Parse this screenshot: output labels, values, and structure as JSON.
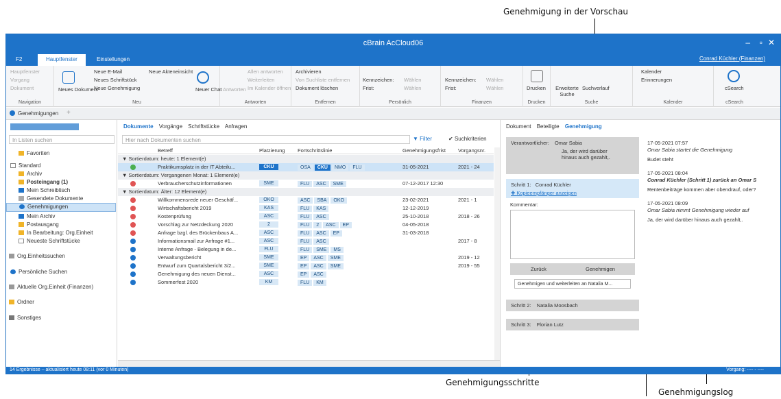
{
  "callouts": {
    "preview": "Genehmigung in der Vorschau",
    "steps": "Genehmigungsschritte",
    "log": "Genehmigungslog"
  },
  "window": {
    "title": "cBrain AcCloud06",
    "user": "Conrad Küchler (Finanzen)"
  },
  "ribbon_tabs": [
    "F2",
    "Hauptfenster",
    "Einstellungen"
  ],
  "ribbon": {
    "navigation": {
      "label": "Navigation",
      "items": [
        "Hauptfenster",
        "Vorgang",
        "Dokument"
      ]
    },
    "neu": {
      "label": "Neu",
      "new_doc": "Neues Dokument",
      "items": [
        "Neue E-Mail",
        "Neues Schriftstück",
        "Neue Genehmigung"
      ],
      "akte": "Neue Akteneinsicht",
      "chat": "Neuer Chat"
    },
    "antworten": {
      "label": "Antworten",
      "antworten": "Antworten",
      "items": [
        "Allen antworten",
        "Weiterleiten",
        "Im Kalender öffnen"
      ]
    },
    "entfernen": {
      "label": "Entfernen",
      "items": [
        "Archivieren",
        "Von Suchliste entfernen",
        "Dokument löschen"
      ]
    },
    "persoenlich": {
      "label": "Persönlich",
      "kennzeichen": "Kennzeichen:",
      "frist": "Frist:",
      "waehlen": "Wählen"
    },
    "finanzen": {
      "label": "Finanzen",
      "kennzeichen": "Kennzeichen:",
      "frist": "Frist:",
      "waehlen": "Wählen"
    },
    "drucken": {
      "label": "Drucken",
      "btn": "Drucken"
    },
    "suche": {
      "label": "Suche",
      "erweiterte": "Erweiterte Suche",
      "verlauf": "Suchverlauf"
    },
    "kalender": {
      "label": "Kalender",
      "kalender": "Kalender",
      "erinnerungen": "Erinnerungen"
    },
    "csearch": {
      "label": "cSearch",
      "btn": "cSearch"
    }
  },
  "doc_tab": "Genehmigungen",
  "sidebar": {
    "search_placeholder": "In Listen suchen",
    "items": [
      "Favoriten",
      "Standard",
      "Archiv",
      "Posteingang (1)",
      "Mein Schreibtisch",
      "Gesendete Dokumente",
      "Genehmigungen",
      "Mein Archiv",
      "Postausgang",
      "In Bearbeitung: Org.Einheit",
      "Neueste Schriftstücke",
      "Org.Einheitssuchen",
      "Persönliche Suchen",
      "Aktuelle Org.Einheit (Finanzen)",
      "Ordner",
      "Sonstiges"
    ]
  },
  "list": {
    "tabs": [
      "Dokumente",
      "Vorgänge",
      "Schriftstücke",
      "Anfragen"
    ],
    "search_placeholder": "Hier nach Dokumenten suchen",
    "filter": "Filter",
    "suchkriterien": "Suchkriterien",
    "columns": [
      "Betreff",
      "Platzierung",
      "Fortschrittslinie",
      "Genehmigungsfrist",
      "Vorgangsnr."
    ],
    "groups": [
      "Sortierdatum: heute: 1 Element(e)",
      "Sortierdatum: Vergangenen Monat: 1 Element(e)",
      "Sortierdatum: Älter: 12 Element(e)"
    ],
    "rows": [
      {
        "subject": "Praktikumsplatz in der IT Abteilu...",
        "place": "CKU",
        "progress": [
          "OSA",
          "CKU",
          "NMO",
          "FLU"
        ],
        "deadline": "31-05-2021",
        "caseno": "2021 - 24",
        "status": "green"
      },
      {
        "subject": "Verbraucherschutzinformationen",
        "place": "SME",
        "progress": [
          "FLU",
          "ASC",
          "SME"
        ],
        "deadline": "07-12-2017 12:30",
        "caseno": "",
        "status": "red"
      },
      {
        "subject": "Willkommensrede neuer Geschäf...",
        "place": "OKO",
        "progress": [
          "ASC",
          "SBA",
          "OKO"
        ],
        "deadline": "23-02-2021",
        "caseno": "2021 - 1",
        "status": "red"
      },
      {
        "subject": "Wirtschaftsbericht 2019",
        "place": "KAS",
        "progress": [
          "FLU",
          "KAS"
        ],
        "deadline": "12-12-2019",
        "caseno": "",
        "status": "red"
      },
      {
        "subject": "Kostenprüfung",
        "place": "ASC",
        "progress": [
          "FLU",
          "ASC"
        ],
        "deadline": "25-10-2018",
        "caseno": "2018 - 26",
        "status": "red"
      },
      {
        "subject": "Vorschlag zur Netzdeckung 2020",
        "place": "2",
        "progress": [
          "FLU",
          "2",
          "ASC",
          "EP"
        ],
        "deadline": "04-05-2018",
        "caseno": "",
        "status": "red"
      },
      {
        "subject": "Anfrage bzgl. des Brückenbaus A...",
        "place": "ASC",
        "progress": [
          "FLU",
          "ASC",
          "EP"
        ],
        "deadline": "31-03-2018",
        "caseno": "",
        "status": "red"
      },
      {
        "subject": "Informationsmail zur Anfrage #1...",
        "place": "ASC",
        "progress": [
          "FLU",
          "ASC"
        ],
        "deadline": "",
        "caseno": "2017 - 8",
        "status": "blue"
      },
      {
        "subject": "Interne Anfrage - Belegung in de...",
        "place": "FLU",
        "progress": [
          "FLU",
          "SME",
          "MS"
        ],
        "deadline": "",
        "caseno": "",
        "status": "blue"
      },
      {
        "subject": "Verwaltungsbericht",
        "place": "SME",
        "progress": [
          "EP",
          "ASC",
          "SME"
        ],
        "deadline": "",
        "caseno": "2019 - 12",
        "status": "blue"
      },
      {
        "subject": "Entwurf zum Quartalsbericht 3/2...",
        "place": "SME",
        "progress": [
          "EP",
          "ASC",
          "SME"
        ],
        "deadline": "",
        "caseno": "2019 - 55",
        "status": "blue"
      },
      {
        "subject": "Genehmigung des neuen Dienst...",
        "place": "ASC",
        "progress": [
          "EP",
          "ASC"
        ],
        "deadline": "",
        "caseno": "",
        "status": "blue"
      },
      {
        "subject": "Sommerfest 2020",
        "place": "KM",
        "progress": [
          "FLU",
          "KM"
        ],
        "deadline": "",
        "caseno": "",
        "status": "blue"
      }
    ]
  },
  "preview": {
    "tabs": [
      "Dokument",
      "Beteiligte",
      "Genehmigung"
    ],
    "verantwortlicher_label": "Verantwortlicher:",
    "verantwortlicher": "Omar Sabia",
    "verantwortlicher_note": "Ja, der wird darüber hinaus auch gezahlt,.",
    "step1_label": "Schritt 1:",
    "step1_name": "Conrad Küchler",
    "kopie": "Kopieempfänger anzeigen",
    "kommentar": "Kommentar:",
    "zurueck": "Zurück",
    "genehmigen": "Genehmigen",
    "weiterleiten": "Genehmigen und weiterleiten an Natalia M...",
    "step2_label": "Schritt 2:",
    "step2_name": "Natalia Moosbach",
    "step3_label": "Schritt 3:",
    "step3_name": "Florian Lutz",
    "log": [
      {
        "time": "17-05-2021 07:57",
        "event": "Omar Sabia startet die Genehmigung",
        "text": "Budet steht"
      },
      {
        "time": "17-05-2021 08:04",
        "event": "Conrad Küchler (Schritt 1) zurück an Omar S",
        "text": "Rentenbeiträge kommen aber obendrauf, oder?"
      },
      {
        "time": "17-05-2021 08:09",
        "event": "Omar Sabia nimmt Genehmigung wieder auf",
        "text": "Ja, der wird darüber hinaus auch gezahlt,."
      }
    ]
  },
  "status": {
    "left": "14 Ergebnisse – aktualisiert heute 08:11 (vor 0 Minuten)",
    "right": "Vorgang: ---- - ----"
  },
  "colors": {
    "accent": "#1e73c9",
    "red": "#e05454",
    "green": "#4caf50"
  }
}
